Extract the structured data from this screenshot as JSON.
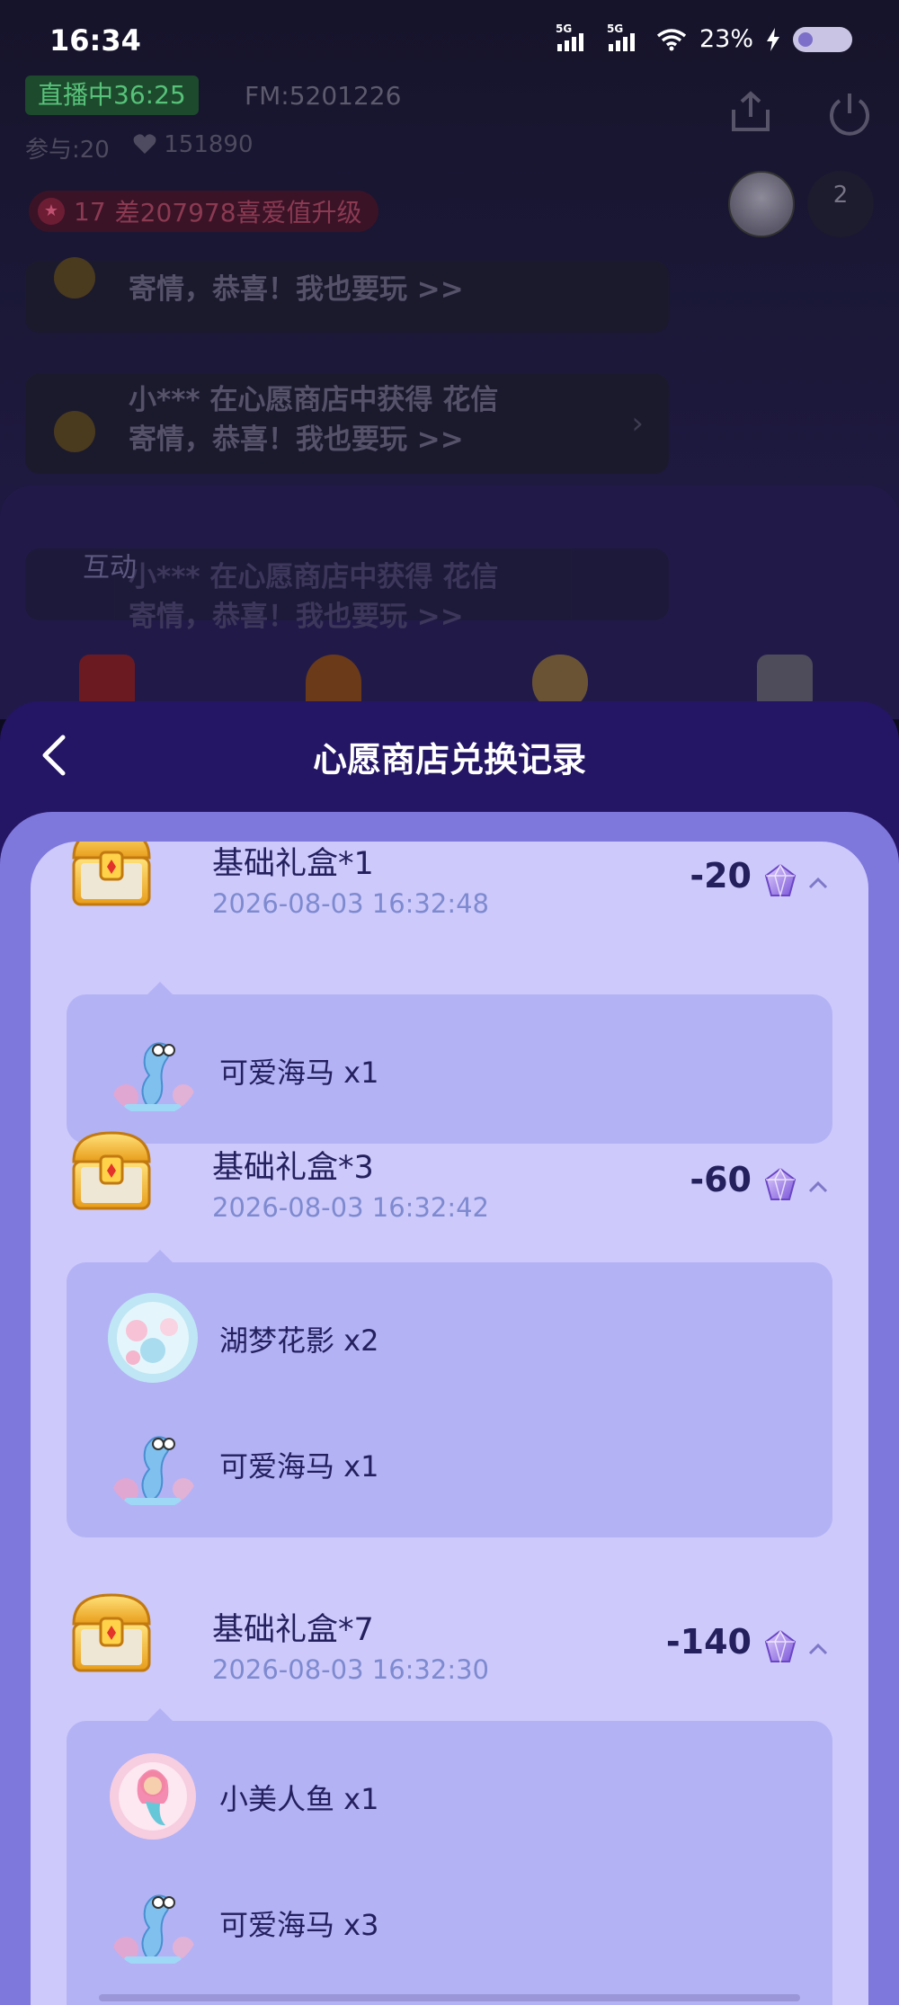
{
  "status_bar": {
    "time": "16:34",
    "signal_1_label": "5G",
    "signal_2_label": "5G",
    "battery": "23%"
  },
  "room": {
    "live_badge": "直播中36:25",
    "fm": "FM:5201226",
    "participants": "参与:20",
    "hearts": "151890",
    "level_number": "17",
    "level_text": "差207978喜爱值升级",
    "viewer_count": "2",
    "messages": [
      {
        "text": "寄情，恭喜！我也要玩 >>"
      },
      {
        "line1": "小*** 在心愿商店中获得 花信",
        "line2": "寄情，恭喜！我也要玩 >>"
      },
      {
        "line1": "小*** 在心愿商店中获得 花信",
        "line2": "寄情，恭喜！我也要玩 >>"
      }
    ],
    "interact_title": "互动"
  },
  "sheet": {
    "title": "心愿商店兑换记录",
    "records": [
      {
        "title": "基础礼盒*1",
        "time": "2026-08-03 16:32:48",
        "amount": "-20",
        "items": [
          {
            "label": "可爱海马 x1",
            "icon": "seahorse-icon"
          }
        ]
      },
      {
        "title": "基础礼盒*3",
        "time": "2026-08-03 16:32:42",
        "amount": "-60",
        "items": [
          {
            "label": "湖梦花影 x2",
            "icon": "lake-dream-icon"
          },
          {
            "label": "可爱海马 x1",
            "icon": "seahorse-icon"
          }
        ]
      },
      {
        "title": "基础礼盒*7",
        "time": "2026-08-03 16:32:30",
        "amount": "-140",
        "items": [
          {
            "label": "小美人鱼 x1",
            "icon": "mermaid-icon"
          },
          {
            "label": "可爱海马 x3",
            "icon": "seahorse-icon"
          }
        ]
      }
    ]
  },
  "colors": {
    "sheet_header": "#251565",
    "list_outer": "#7e78dc",
    "list_inner": "#cdc9fb",
    "item_box": "#b3b2f5",
    "text_dark": "#24205e",
    "text_time": "#7e8ad0"
  }
}
